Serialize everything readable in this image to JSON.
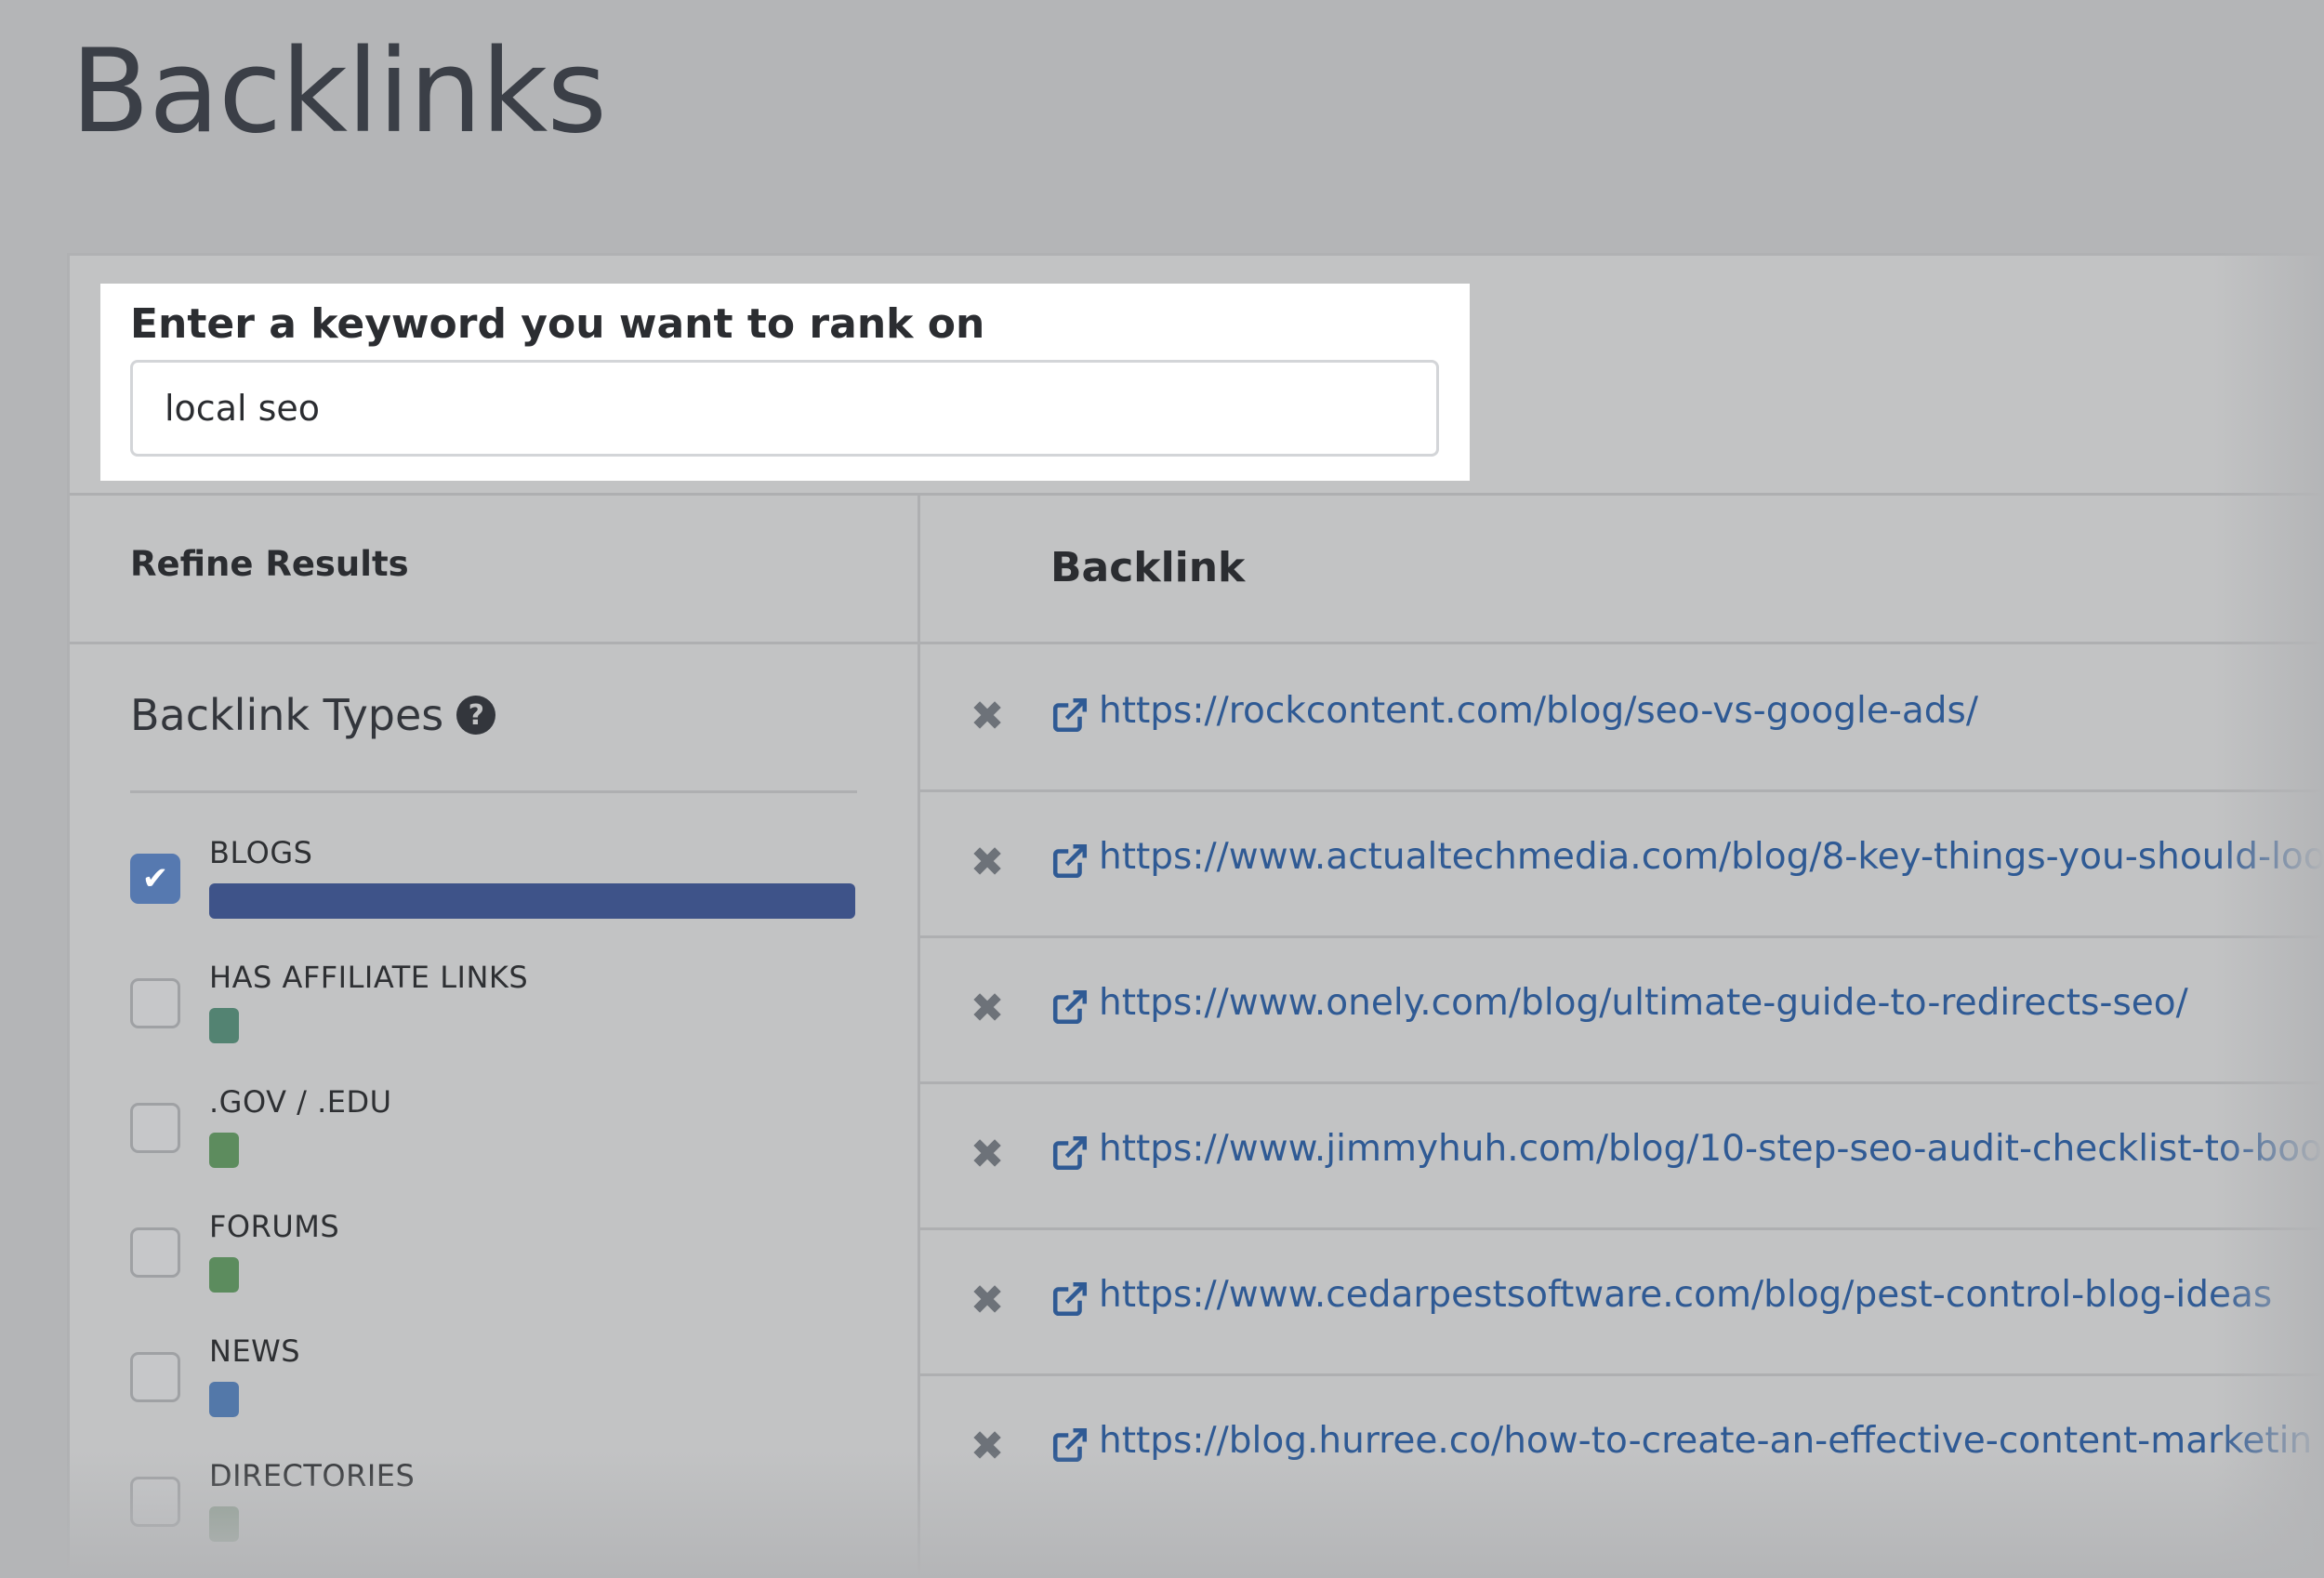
{
  "page": {
    "title": "Backlinks"
  },
  "keyword": {
    "label": "Enter a keyword you want to rank on",
    "value": "local seo"
  },
  "refine": {
    "title": "Refine Results",
    "types_title": "Backlink Types",
    "help_icon": "question-circle-icon",
    "filters": [
      {
        "label": "BLOGS",
        "checked": true,
        "bar_color": "#3e5389",
        "bar_fraction": 1.0
      },
      {
        "label": "HAS AFFILIATE LINKS",
        "checked": false,
        "bar_color": "#538372"
      },
      {
        "label": ".GOV / .EDU",
        "checked": false,
        "bar_color": "#5d8c5e"
      },
      {
        "label": "FORUMS",
        "checked": false,
        "bar_color": "#5c8c5e"
      },
      {
        "label": "NEWS",
        "checked": false,
        "bar_color": "#5378a9"
      },
      {
        "label": "DIRECTORIES",
        "checked": false,
        "bar_color": "#8b9c8f"
      }
    ]
  },
  "backlinks": {
    "header": "Backlink",
    "remove_icon": "close-icon",
    "link_icon": "external-link-icon",
    "rows": [
      {
        "url": "https://rockcontent.com/blog/seo-vs-google-ads/"
      },
      {
        "url": "https://www.actualtechmedia.com/blog/8-key-things-you-should-loo"
      },
      {
        "url": "https://www.onely.com/blog/ultimate-guide-to-redirects-seo/"
      },
      {
        "url": "https://www.jimmyhuh.com/blog/10-step-seo-audit-checklist-to-boo"
      },
      {
        "url": "https://www.cedarpestsoftware.com/blog/pest-control-blog-ideas"
      },
      {
        "url": "https://blog.hurree.co/how-to-create-an-effective-content-marketin"
      }
    ]
  },
  "colors": {
    "background": "#b4b5b7",
    "card": "#c2c3c4",
    "link": "#2f5a94",
    "checkbox_checked": "#5679b0"
  }
}
